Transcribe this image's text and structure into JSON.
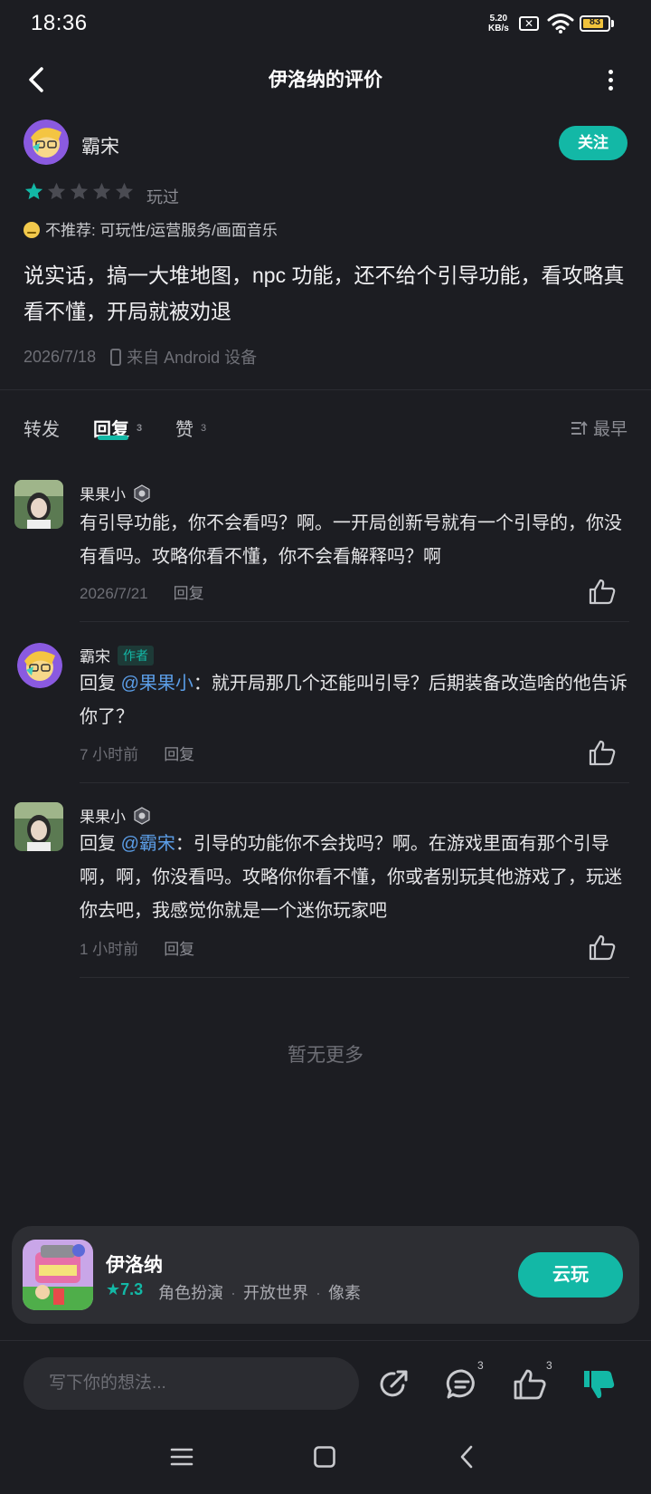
{
  "status_bar": {
    "time": "18:36",
    "net_speed_value": "5.20",
    "net_speed_unit": "KB/s",
    "battery": "83"
  },
  "header": {
    "title": "伊洛纳的评价"
  },
  "review": {
    "author": "霸宋",
    "follow_label": "关注",
    "stars_filled": 1,
    "stars_total": 5,
    "played_label": "玩过",
    "not_recommend": "不推荐: 可玩性/运营服务/画面音乐",
    "text": "说实话，搞一大堆地图，npc 功能，还不给个引导功能，看攻略真看不懂，开局就被劝退",
    "date": "2026/7/18",
    "device": "来自 Android 设备"
  },
  "tabs": [
    {
      "label": "转发",
      "count": ""
    },
    {
      "label": "回复",
      "count": "3"
    },
    {
      "label": "赞",
      "count": "3"
    }
  ],
  "sort_label": "最早",
  "comments": [
    {
      "name": "果果小",
      "is_author": false,
      "reply_prefix": "",
      "mention": "",
      "text": "有引导功能，你不会看吗？啊。一开局创新号就有一个引导的，你没有看吗。攻略你看不懂，你不会看解释吗？啊",
      "time": "2026/7/21",
      "reply_label": "回复"
    },
    {
      "name": "霸宋",
      "is_author": true,
      "author_tag": "作者",
      "reply_prefix": "回复",
      "mention": "@果果小",
      "text": "：就开局那几个还能叫引导？后期装备改造啥的他告诉你了？",
      "time": "7 小时前",
      "reply_label": "回复"
    },
    {
      "name": "果果小",
      "is_author": false,
      "reply_prefix": "回复",
      "mention": "@霸宋",
      "text": "：引导的功能你不会找吗？啊。在游戏里面有那个引导啊，啊，你没看吗。攻略你你看不懂，你或者别玩其他游戏了，玩迷你去吧，我感觉你就是一个迷你玩家吧",
      "time": "1 小时前",
      "reply_label": "回复"
    }
  ],
  "no_more": "暂无更多",
  "game_card": {
    "name": "伊洛纳",
    "rating": "7.3",
    "tags": [
      "角色扮演",
      "开放世界",
      "像素"
    ],
    "play_label": "云玩"
  },
  "bottom_bar": {
    "input_placeholder": "写下你的想法...",
    "comment_count": "3",
    "like_count": "3"
  },
  "colors": {
    "accent": "#13b8a6",
    "background": "#1c1d22",
    "mention": "#5b9de6"
  }
}
